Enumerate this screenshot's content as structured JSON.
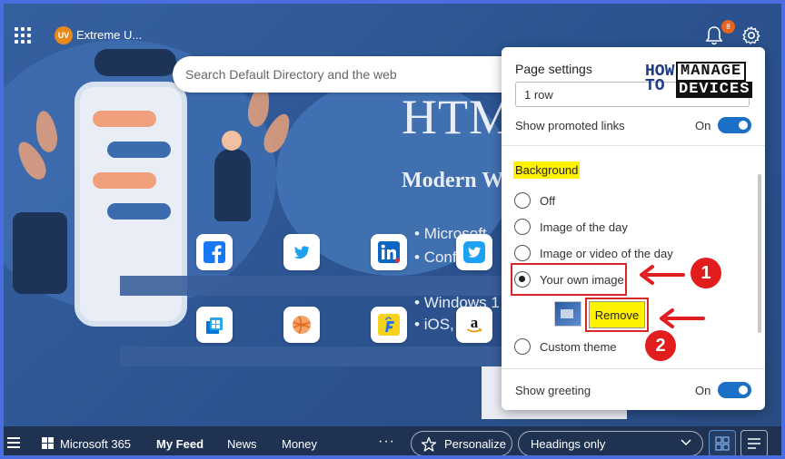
{
  "topbar": {
    "brand_logo_text": "UV",
    "brand_name": "Extreme U...",
    "notification_count": "8"
  },
  "search": {
    "placeholder": "Search Default Directory and the web"
  },
  "background_image": {
    "title": "HTM",
    "subtitle": "Modern W",
    "bullets": [
      "Microsoft",
      "Configu",
      "Windows 1",
      "iOS, A"
    ]
  },
  "quick_links": [
    {
      "name": "Facebook",
      "icon": "facebook-icon",
      "color": "#1877f2"
    },
    {
      "name": "Twitter",
      "icon": "twitter-icon",
      "color": "#1da1f2"
    },
    {
      "name": "LinkedIn",
      "icon": "linkedin-icon",
      "color": "#0a66c2"
    },
    {
      "name": "Twitter",
      "icon": "twitter-square-icon",
      "color": "#1da1f2"
    },
    {
      "name": "Microsoft Store",
      "icon": "store-icon",
      "color": "#0078d4"
    },
    {
      "name": "Rewards",
      "icon": "ball-icon",
      "color": "#e8712b"
    },
    {
      "name": "Flipkart",
      "icon": "flipkart-icon",
      "color": "#f7d21c"
    },
    {
      "name": "Amazon",
      "icon": "amazon-icon",
      "color": "#111111"
    }
  ],
  "settings": {
    "title": "Page settings",
    "layout_value": "1 row",
    "promoted_links_label": "Show promoted links",
    "promoted_links_state": "On",
    "background_heading": "Background",
    "options": [
      {
        "label": "Off",
        "checked": false
      },
      {
        "label": "Image of the day",
        "checked": false
      },
      {
        "label": "Image or video of the day",
        "checked": false
      },
      {
        "label": "Your own image",
        "checked": true
      },
      {
        "label": "Custom theme",
        "checked": false
      }
    ],
    "remove_label": "Remove",
    "greeting_label": "Show greeting",
    "greeting_state": "On"
  },
  "watermark": {
    "how_to": "HOW TO",
    "manage": "MANAGE",
    "devices": "DEVICES"
  },
  "callouts": [
    "1",
    "2"
  ],
  "bottombar": {
    "microsoft_365": "Microsoft 365",
    "my_feed": "My Feed",
    "news": "News",
    "money": "Money",
    "more": "···",
    "personalize": "Personalize",
    "headings": "Headings only"
  },
  "colors": {
    "accent": "#1b6fc7",
    "highlight": "#fff200",
    "annotation_red": "#e21d1d",
    "bottom_bar": "#1f3252"
  }
}
